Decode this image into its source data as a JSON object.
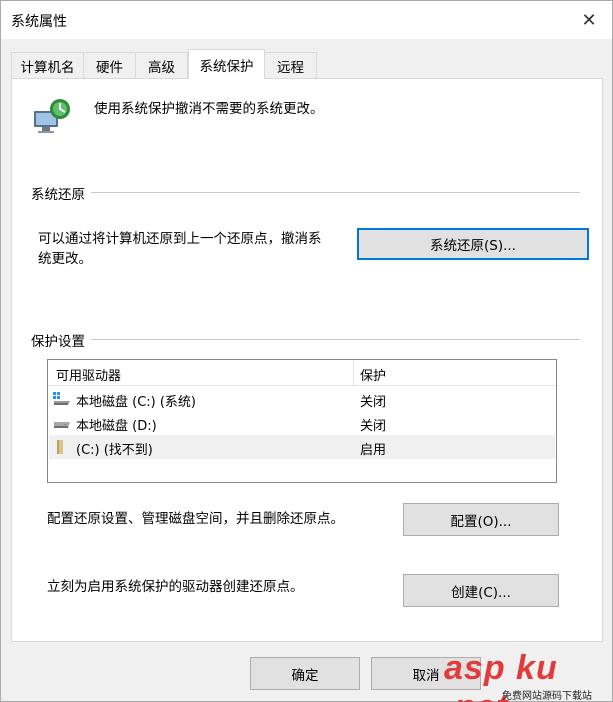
{
  "window": {
    "title": "系统属性"
  },
  "tabs": [
    {
      "label": "计算机名"
    },
    {
      "label": "硬件"
    },
    {
      "label": "高级"
    },
    {
      "label": "系统保护"
    },
    {
      "label": "远程"
    }
  ],
  "intro": {
    "text": "使用系统保护撤消不需要的系统更改。"
  },
  "restore_group": {
    "label": "系统还原",
    "description_line1": "可以通过将计算机还原到上一个还原点，撤消系",
    "description_line2": "统更改。",
    "button_label": "系统还原(S)..."
  },
  "protection_group": {
    "label": "保护设置",
    "columns": [
      "可用驱动器",
      "保护"
    ],
    "drives": [
      {
        "name": "本地磁盘 (C:) (系统)",
        "protection": "关闭",
        "icon": "system-drive-icon"
      },
      {
        "name": "本地磁盘 (D:)",
        "protection": "关闭",
        "icon": "drive-icon"
      },
      {
        "name": "(C:) (找不到)",
        "protection": "启用",
        "icon": "folder-drive-icon"
      }
    ],
    "configure_text": "配置还原设置、管理磁盘空间，并且删除还原点。",
    "configure_button": "配置(O)...",
    "create_text": "立刻为启用系统保护的驱动器创建还原点。",
    "create_button": "创建(C)..."
  },
  "footer": {
    "ok_label": "确定",
    "cancel_label": "取消"
  },
  "watermark": {
    "text": "asp ku .net",
    "sub": "免费网站源码下载站"
  }
}
